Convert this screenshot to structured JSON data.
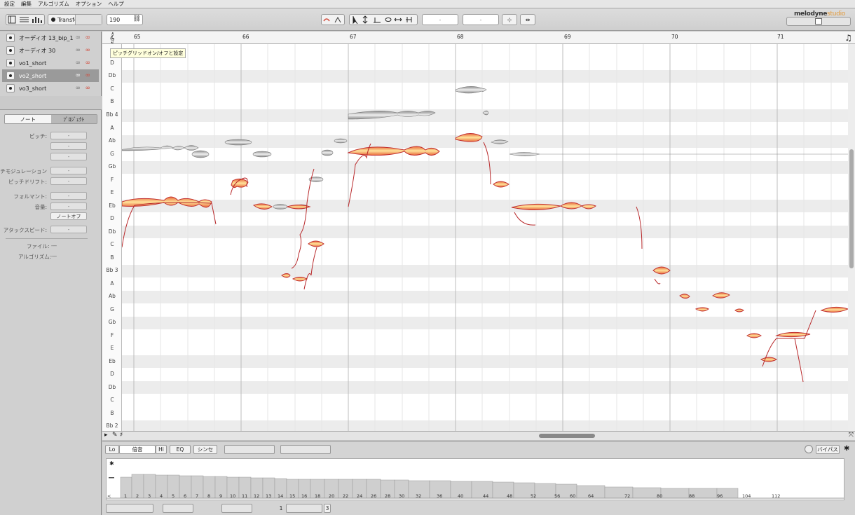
{
  "menu": [
    "設定",
    "編集",
    "アルゴリズム",
    "オプション",
    "ヘルプ"
  ],
  "toolbar": {
    "transfer_label": "Transfer",
    "tempo": "190",
    "field_a": "-",
    "field_b": "-",
    "app_name": "melodyne",
    "edition": "studio"
  },
  "tracks": [
    {
      "name": "オーディオ 13_bip_1",
      "selected": false
    },
    {
      "name": "オーディオ 30",
      "selected": false
    },
    {
      "name": "vo1_short",
      "selected": false
    },
    {
      "name": "vo2_short",
      "selected": true
    },
    {
      "name": "vo3_short",
      "selected": false
    }
  ],
  "inspector": {
    "tab_note": "ノート",
    "tab_project": "ﾌﾟﾛｼﾞｪｸﾄ",
    "pitch_label": "ピッチ:",
    "modulation_label": "ピッチモジュレーション:",
    "drift_label": "ピッチドリフト:",
    "formant_label": "フォルマント:",
    "volume_label": "音量:",
    "note_off_label": "ノートオフ",
    "attack_label": "アタックスピード:",
    "file_label": "ファイル:",
    "file_value": "---",
    "algorithm_label": "アルゴリズム:",
    "algorithm_value": "---",
    "dash": "-"
  },
  "tooltip": "ピッチグリッドオン/オフと設定",
  "bars": [
    "65",
    "66",
    "67",
    "68",
    "69",
    "70",
    "71"
  ],
  "pitch_keys": [
    "D",
    "Db",
    "C",
    "B",
    "Bb 4",
    "A",
    "Ab",
    "G",
    "Gb",
    "F",
    "E",
    "Eb",
    "D",
    "Db",
    "C",
    "B",
    "Bb 3",
    "A",
    "Ab",
    "G",
    "Gb",
    "F",
    "E",
    "Eb",
    "D",
    "Db",
    "C",
    "B",
    "Bb 2"
  ],
  "bottom": {
    "lo": "Lo",
    "overtones": "倍音",
    "hi": "Hi",
    "eq": "EQ",
    "synth": "シンセ",
    "bypass": "バイパス",
    "lt": "<",
    "harmonics": [
      "1",
      "2",
      "3",
      "4",
      "5",
      "6",
      "7",
      "8",
      "9",
      "10",
      "11",
      "12",
      "13",
      "14",
      "15",
      "16",
      "18",
      "20",
      "22",
      "24",
      "26",
      "28",
      "30",
      "32",
      "36",
      "40",
      "44",
      "48",
      "52",
      "56",
      "60",
      "64",
      "72",
      "80",
      "88",
      "96",
      "104",
      "112"
    ],
    "page_a": "1",
    "page_b": "3"
  }
}
